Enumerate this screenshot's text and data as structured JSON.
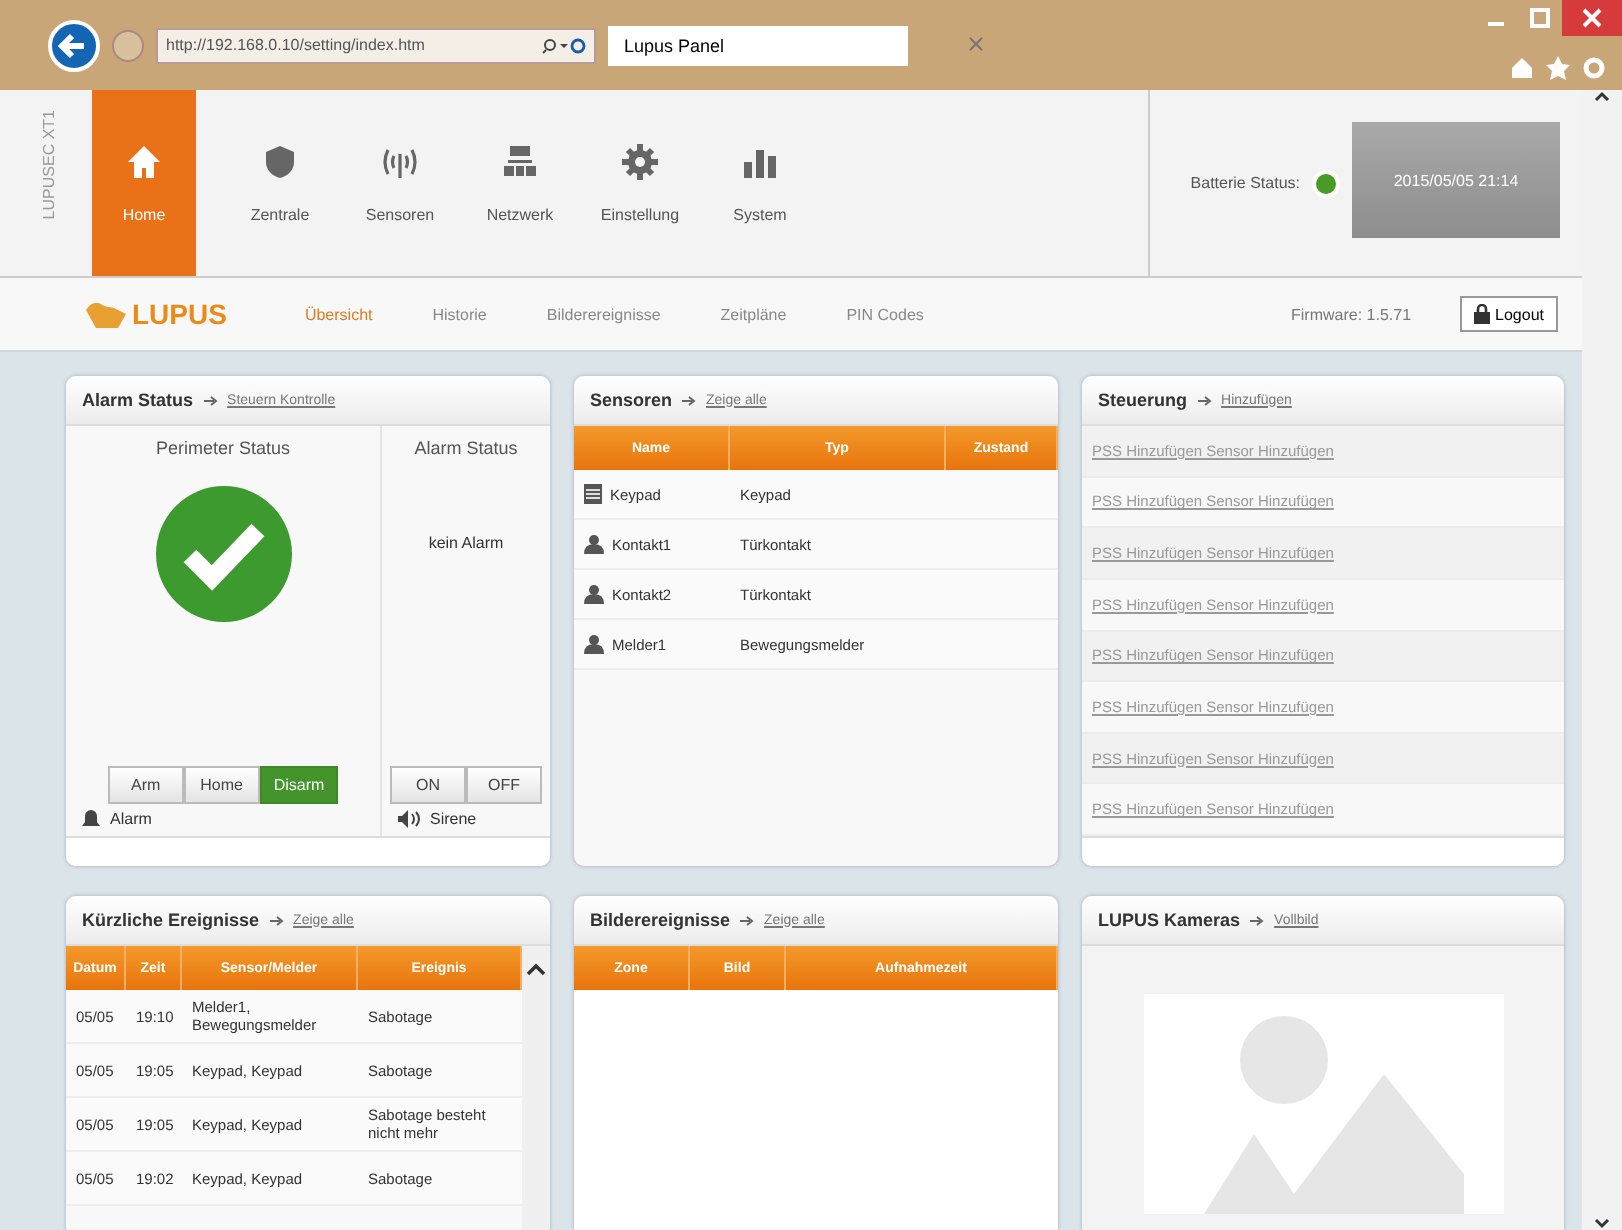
{
  "browser": {
    "address": "http://192.168.0.10/setting/index.htm",
    "tab_title": "Lupus Panel"
  },
  "header": {
    "brand": "LUPUSEC XT1",
    "nav": [
      {
        "label": "Home",
        "kind": "home",
        "selected": true
      },
      {
        "label": "Zentrale",
        "kind": "shield",
        "selected": false
      },
      {
        "label": "Sensoren",
        "kind": "sensor",
        "selected": false
      },
      {
        "label": "Netzwerk",
        "kind": "network",
        "selected": false
      },
      {
        "label": "Einstellung",
        "kind": "gear",
        "selected": false
      },
      {
        "label": "System",
        "kind": "chart",
        "selected": false
      }
    ],
    "battery_label": "Batterie Status:",
    "battery_ok": true,
    "datetime": "2015/05/05 21:14"
  },
  "subnav": {
    "logo": "LUPUS",
    "tabs": [
      {
        "label": "Übersicht",
        "selected": true
      },
      {
        "label": "Historie",
        "selected": false
      },
      {
        "label": "Bilderereignisse",
        "selected": false
      },
      {
        "label": "Zeitpläne",
        "selected": false
      },
      {
        "label": "PIN Codes",
        "selected": false
      }
    ],
    "firmware": "Firmware: 1.5.71",
    "logout": "Logout"
  },
  "alarm": {
    "title": "Alarm Status",
    "link": "Steuern Kontrolle",
    "perimeter_title": "Perimeter Status",
    "perimeter_ok": true,
    "alarm_title": "Alarm Status",
    "alarm_text": "kein Alarm",
    "modes": [
      {
        "label": "Arm",
        "selected": false
      },
      {
        "label": "Home",
        "selected": false
      },
      {
        "label": "Disarm",
        "selected": true
      }
    ],
    "mode_label": "Alarm",
    "siren": [
      {
        "label": "ON",
        "selected": false
      },
      {
        "label": "OFF",
        "selected": false
      }
    ],
    "siren_label": "Sirene"
  },
  "sensors": {
    "title": "Sensoren",
    "link": "Zeige alle",
    "columns": [
      "Name",
      "Typ",
      "Zustand"
    ],
    "rows": [
      {
        "kind": "keypad",
        "name": "Keypad",
        "type": "Keypad"
      },
      {
        "kind": "person",
        "name": "Kontakt1",
        "type": "Türkontakt"
      },
      {
        "kind": "person",
        "name": "Kontakt2",
        "type": "Türkontakt"
      },
      {
        "kind": "person",
        "name": "Melder1",
        "type": "Bewegungsmelder"
      }
    ]
  },
  "control": {
    "title": "Steuerung",
    "link": "Hinzufügen",
    "items": [
      "PSS Hinzufügen Sensor Hinzufügen",
      "PSS Hinzufügen Sensor Hinzufügen",
      "PSS Hinzufügen Sensor Hinzufügen",
      "PSS Hinzufügen Sensor Hinzufügen",
      "PSS Hinzufügen Sensor Hinzufügen",
      "PSS Hinzufügen Sensor Hinzufügen",
      "PSS Hinzufügen Sensor Hinzufügen",
      "PSS Hinzufügen Sensor Hinzufügen"
    ]
  },
  "events": {
    "title": "Kürzliche Ereignisse",
    "link": "Zeige alle",
    "columns": [
      "Datum",
      "Zeit",
      "Sensor/Melder",
      "Ereignis"
    ],
    "rows": [
      [
        "05/05",
        "19:10",
        "Melder1, Bewegungsmelder",
        "Sabotage"
      ],
      [
        "05/05",
        "19:05",
        "Keypad, Keypad",
        "Sabotage"
      ],
      [
        "05/05",
        "19:05",
        "Keypad, Keypad",
        "Sabotage besteht nicht mehr"
      ],
      [
        "05/05",
        "19:02",
        "Keypad, Keypad",
        "Sabotage"
      ]
    ]
  },
  "images": {
    "title": "Bilderereignisse",
    "link": "Zeige alle",
    "columns": [
      "Zone",
      "Bild",
      "Aufnahmezeit"
    ]
  },
  "cameras": {
    "title": "LUPUS Kameras",
    "link": "Vollbild"
  }
}
